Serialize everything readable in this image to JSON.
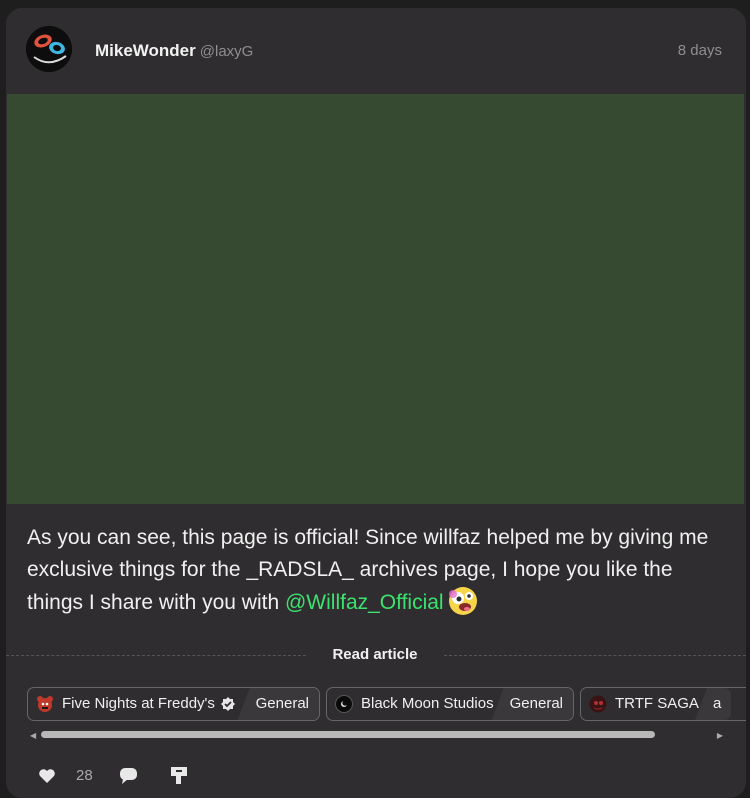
{
  "post": {
    "author_name": "MikeWonder",
    "author_handle": "@laxyG",
    "timestamp": "8 days",
    "text_before_mention": "As you can see, this page is official! Since willfaz helped me by giving me exclusive things for the _RADSLA_ archives page, I hope you like the things I share with you with ",
    "mention": "@Willfaz_Official",
    "media_color": "#354a30"
  },
  "read_article_label": "Read article",
  "communities": [
    {
      "name": "Five Nights at Freddy's",
      "category": "General",
      "verified": true,
      "icon": "freddy-icon"
    },
    {
      "name": "Black Moon Studios",
      "category": "General",
      "verified": false,
      "icon": "black-moon-icon"
    },
    {
      "name": "TRTF SAGA",
      "category": "a",
      "verified": false,
      "icon": "trtf-icon"
    }
  ],
  "footer": {
    "likes": "28",
    "icons": [
      "heart-icon",
      "comment-icon",
      "repost-icon"
    ]
  },
  "colors": {
    "mention": "#3ce26f",
    "card_bg": "#2f2d2f",
    "page_bg": "#1f1e1f"
  }
}
